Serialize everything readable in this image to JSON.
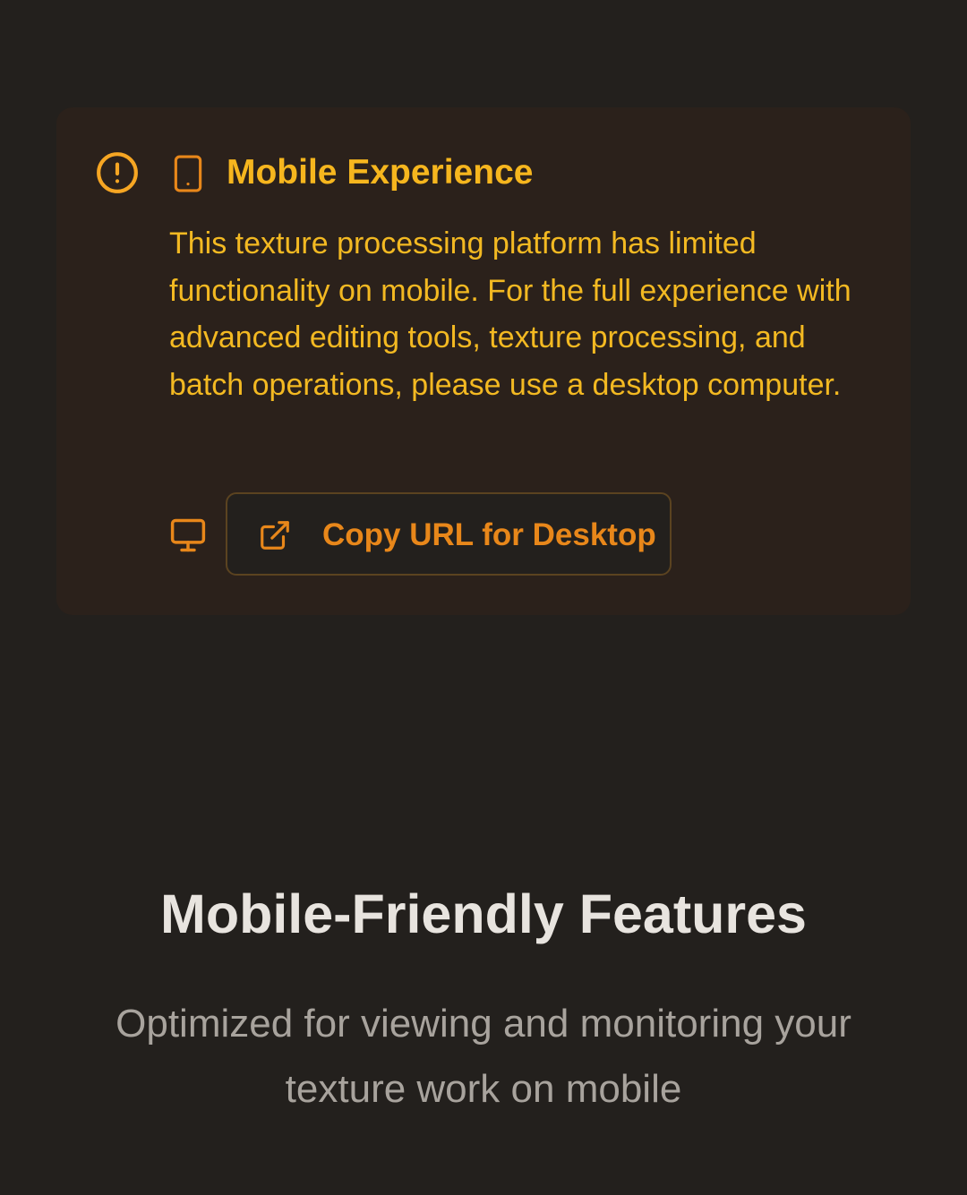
{
  "alert": {
    "icon": "alert-circle-icon",
    "device_icon": "smartphone-icon",
    "title": "Mobile Experience",
    "body": "This texture processing platform has limited functionality on mobile. For the full experience with advanced editing tools, texture processing, and batch operations, please use a desktop computer.",
    "monitor_icon": "monitor-icon",
    "button_icon": "external-link-icon",
    "button_label": "Copy URL for Desktop",
    "colors": {
      "card_background": "#2b211b",
      "title": "#f6b61e",
      "body_text": "#f3b922",
      "accent": "#e8871a"
    }
  },
  "features": {
    "title": "Mobile-Friendly Features",
    "subtitle": "Optimized for viewing and monitoring your texture work on mobile"
  },
  "colors": {
    "page_background": "#23201d",
    "heading": "#e8e4df",
    "muted_text": "#a8a39d"
  }
}
